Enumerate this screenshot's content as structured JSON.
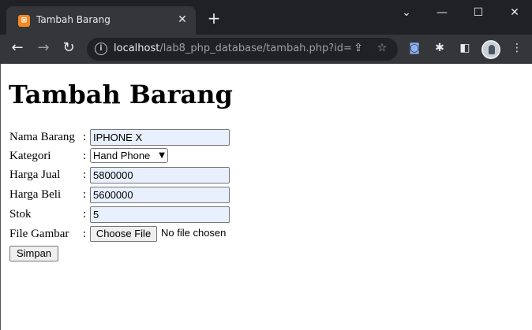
{
  "browser": {
    "tab_title": "Tambah Barang",
    "tab_favicon": "xampp-icon",
    "url_host": "localhost",
    "url_path": "/lab8_php_database/tambah.php?id="
  },
  "page": {
    "heading": "Tambah Barang",
    "form": {
      "fields": [
        {
          "label": "Nama Barang",
          "value": "IPHONE X"
        },
        {
          "label": "Kategori",
          "value": "Hand Phone"
        },
        {
          "label": "Harga Jual",
          "value": "5800000"
        },
        {
          "label": "Harga Beli",
          "value": "5600000"
        },
        {
          "label": "Stok",
          "value": "5"
        },
        {
          "label": "File Gambar",
          "button": "Choose File",
          "status": "No file chosen"
        }
      ],
      "separator": ":",
      "submit_label": "Simpan"
    }
  }
}
